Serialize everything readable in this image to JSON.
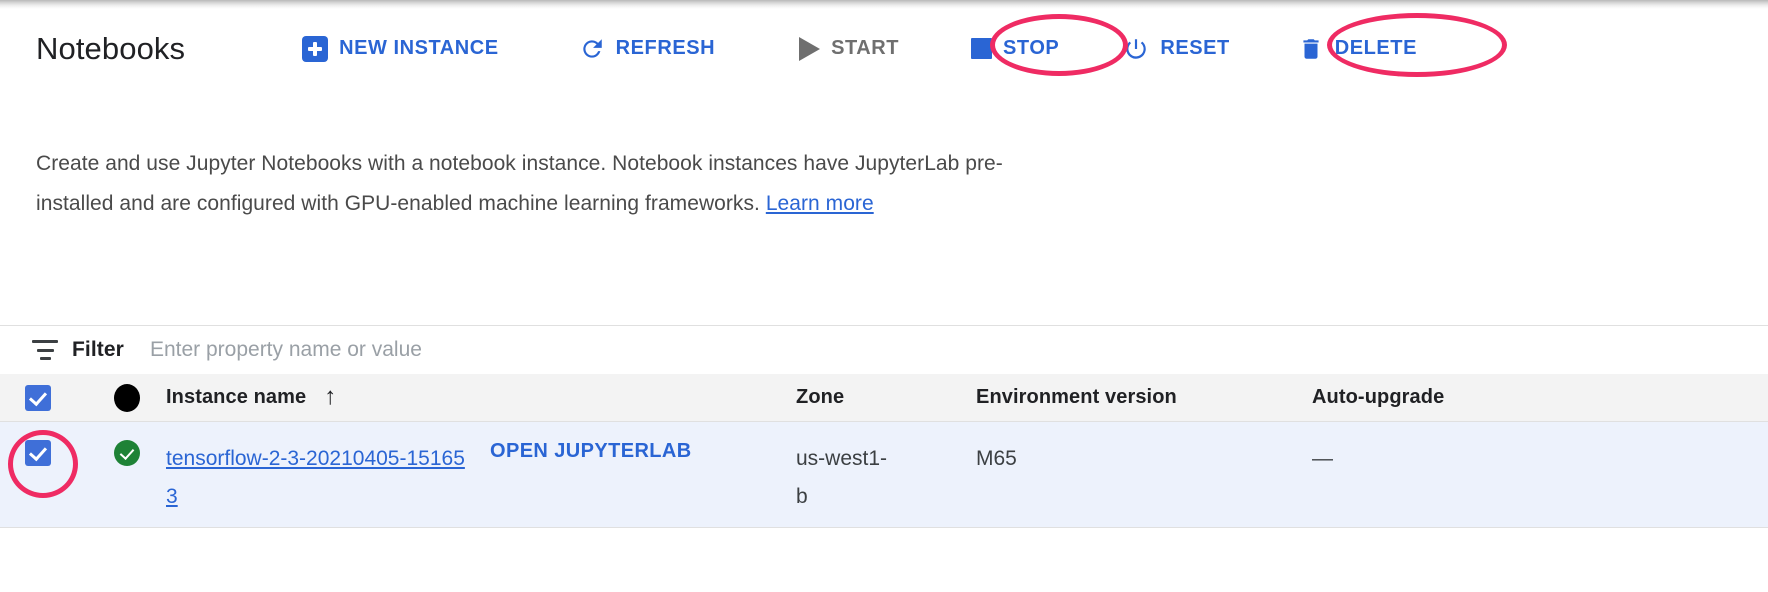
{
  "header": {
    "title": "Notebooks",
    "toolbar": [
      {
        "id": "new-instance",
        "label": "NEW INSTANCE",
        "icon": "plus-icon",
        "state": "enabled",
        "annotated": false
      },
      {
        "id": "refresh",
        "label": "REFRESH",
        "icon": "refresh-icon",
        "state": "enabled",
        "annotated": false
      },
      {
        "id": "start",
        "label": "START",
        "icon": "play-icon",
        "state": "disabled",
        "annotated": false
      },
      {
        "id": "stop",
        "label": "STOP",
        "icon": "stop-icon",
        "state": "enabled",
        "annotated": true
      },
      {
        "id": "reset",
        "label": "RESET",
        "icon": "power-icon",
        "state": "enabled",
        "annotated": false
      },
      {
        "id": "delete",
        "label": "DELETE",
        "icon": "trash-icon",
        "state": "enabled",
        "annotated": true
      }
    ]
  },
  "description": {
    "text": "Create and use Jupyter Notebooks with a notebook instance. Notebook instances have JupyterLab pre-installed and are configured with GPU-enabled machine learning frameworks. ",
    "link_label": "Learn more"
  },
  "filter": {
    "icon": "filter-icon",
    "label": "Filter",
    "placeholder": "Enter property name or value",
    "value": ""
  },
  "table": {
    "headers": {
      "select_all": "",
      "status": "",
      "instance_name": "Instance name",
      "sort_indicator": "↑",
      "open_action": "",
      "zone": "Zone",
      "environment_version": "Environment version",
      "auto_upgrade": "Auto-upgrade"
    },
    "rows": [
      {
        "checked": true,
        "status": "running",
        "instance_name": "tensorflow-2-3-20210405-151653",
        "open_action": "OPEN JUPYTERLAB",
        "zone": "us-west1-b",
        "environment_version": "M65",
        "auto_upgrade": "—"
      }
    ]
  },
  "annotations": {
    "color": "#ef2b63",
    "targets": [
      "stop-button",
      "delete-button",
      "row-checkbox"
    ]
  },
  "colors": {
    "accent_blue": "#2a65d4",
    "checkbox_blue": "#3f6fd8",
    "status_green": "#1e8236",
    "row_selected_bg": "#edf2fc",
    "header_row_bg": "#f3f3f3",
    "annotation_pink": "#ef2b63",
    "disabled_grey": "#6f6f6f"
  }
}
